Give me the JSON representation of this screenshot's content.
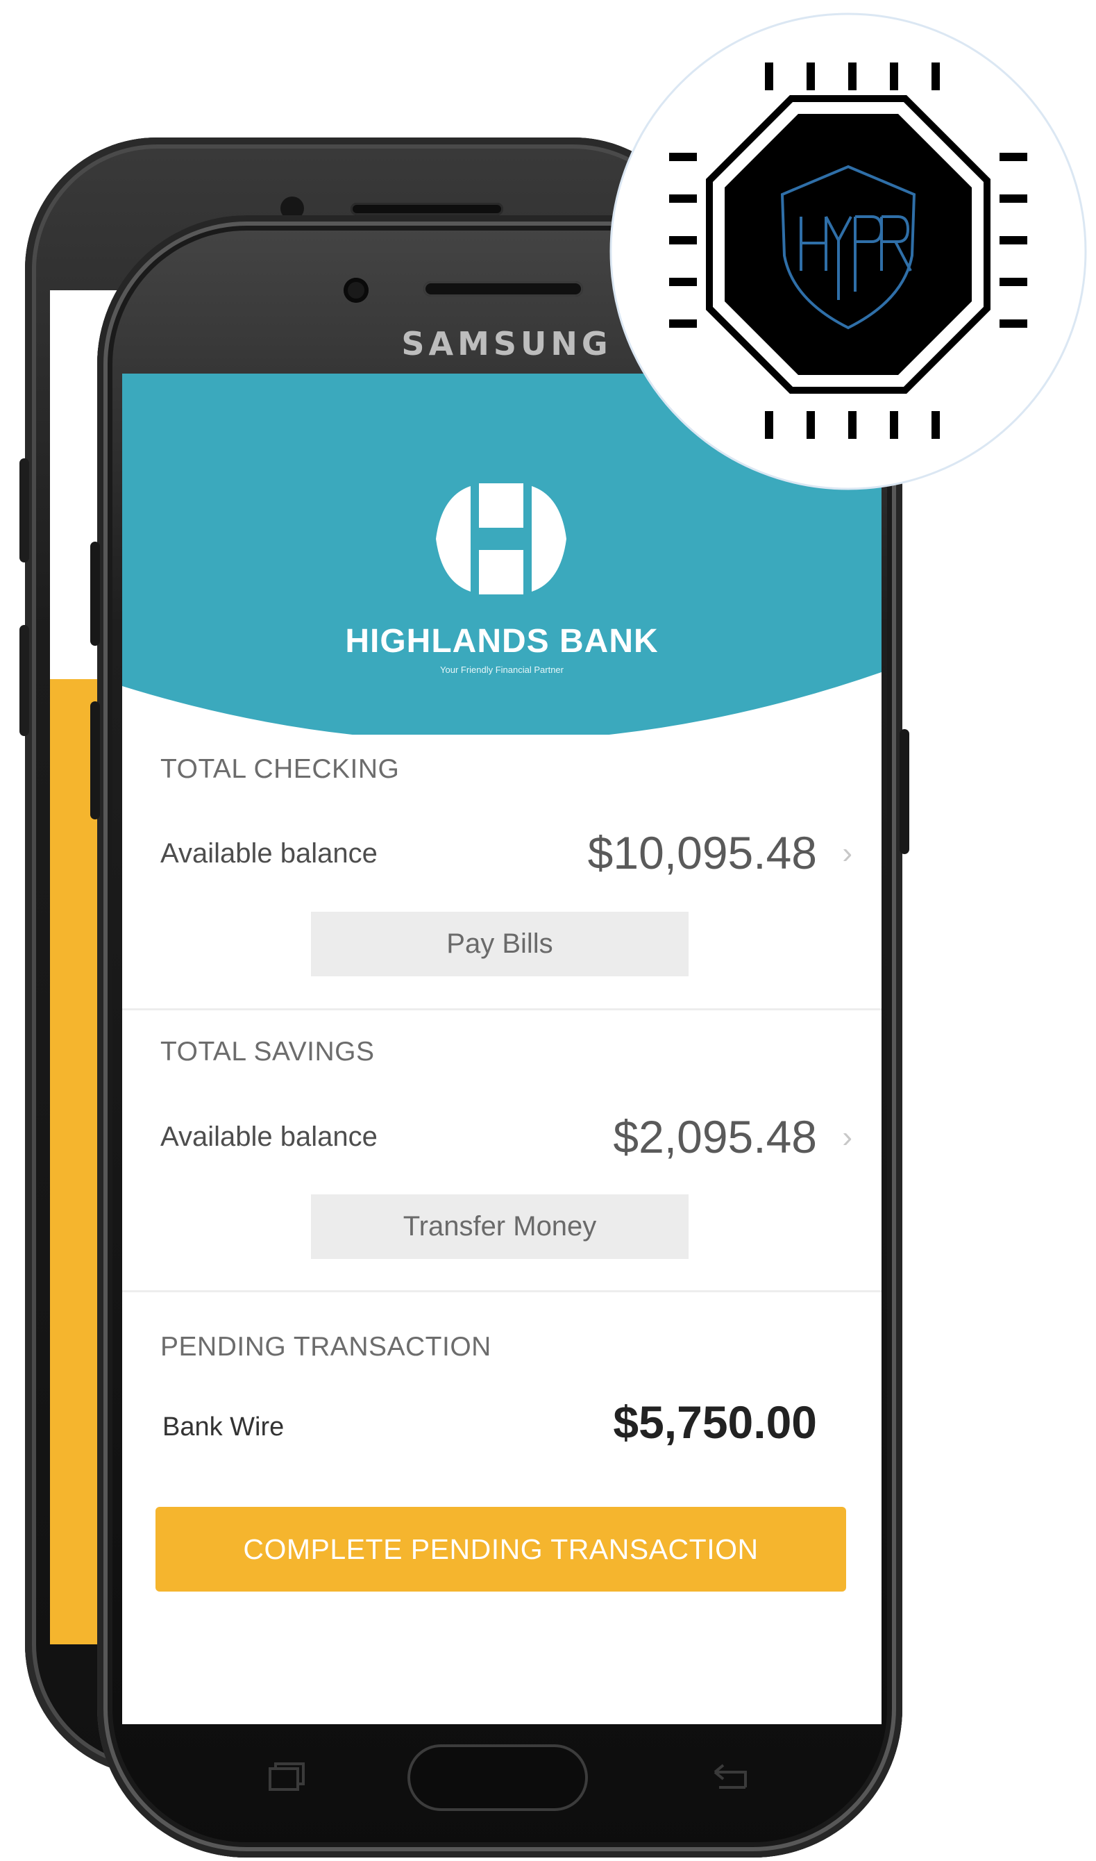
{
  "device": {
    "brand": "SAMSUNG"
  },
  "bank": {
    "name": "HIGHLANDS BANK",
    "tagline": "Your Friendly Financial Partner",
    "header_color": "#3ba9bd"
  },
  "accounts": [
    {
      "section": "TOTAL CHECKING",
      "label": "Available balance",
      "amount": "$10,095.48",
      "chevron": "›",
      "action": "Pay Bills"
    },
    {
      "section": "TOTAL  SAVINGS",
      "label": "Available balance",
      "amount": "$2,095.48",
      "chevron": "›",
      "action": "Transfer Money"
    }
  ],
  "pending": {
    "section": "PENDING TRANSACTION",
    "label": "Bank Wire",
    "amount": "$5,750.00",
    "cta": "COMPLETE PENDING TRANSACTION",
    "cta_color": "#f5b52e"
  },
  "badge": {
    "text": "HYPR",
    "icon": "hypr-chip-icon",
    "accent": "#2f6fa8"
  },
  "nav_icons": [
    "recent-apps-icon",
    "home-button",
    "back-icon"
  ]
}
